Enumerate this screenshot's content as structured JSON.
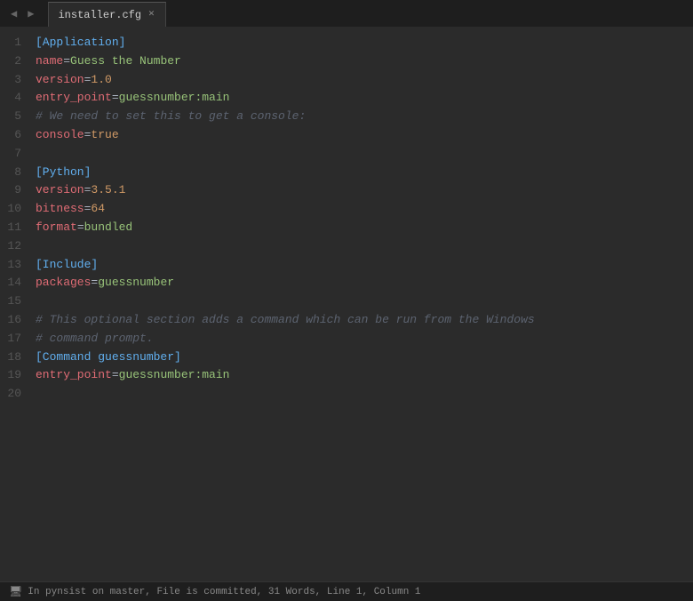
{
  "titleBar": {
    "navBack": "◀",
    "navForward": "▶",
    "tab": {
      "label": "installer.cfg",
      "closeIcon": "✕"
    }
  },
  "lines": [
    {
      "num": 1,
      "tokens": [
        {
          "text": "[Application]",
          "cls": "section"
        }
      ]
    },
    {
      "num": 2,
      "tokens": [
        {
          "text": "name",
          "cls": "key"
        },
        {
          "text": "=",
          "cls": "plain"
        },
        {
          "text": "Guess the Number",
          "cls": "value"
        }
      ]
    },
    {
      "num": 3,
      "tokens": [
        {
          "text": "version",
          "cls": "key"
        },
        {
          "text": "=",
          "cls": "plain"
        },
        {
          "text": "1.0",
          "cls": "value-num"
        }
      ]
    },
    {
      "num": 4,
      "tokens": [
        {
          "text": "entry_point",
          "cls": "key"
        },
        {
          "text": "=",
          "cls": "plain"
        },
        {
          "text": "guessnumber:main",
          "cls": "value"
        }
      ]
    },
    {
      "num": 5,
      "tokens": [
        {
          "text": "# We need to set this to get a console:",
          "cls": "comment"
        }
      ]
    },
    {
      "num": 6,
      "tokens": [
        {
          "text": "console",
          "cls": "key"
        },
        {
          "text": "=",
          "cls": "plain"
        },
        {
          "text": "true",
          "cls": "value-bool"
        }
      ]
    },
    {
      "num": 7,
      "tokens": []
    },
    {
      "num": 8,
      "tokens": [
        {
          "text": "[Python]",
          "cls": "section"
        }
      ]
    },
    {
      "num": 9,
      "tokens": [
        {
          "text": "version",
          "cls": "key"
        },
        {
          "text": "=",
          "cls": "plain"
        },
        {
          "text": "3.5.1",
          "cls": "value-num"
        }
      ]
    },
    {
      "num": 10,
      "tokens": [
        {
          "text": "bitness",
          "cls": "key"
        },
        {
          "text": "=",
          "cls": "plain"
        },
        {
          "text": "64",
          "cls": "value-num"
        }
      ]
    },
    {
      "num": 11,
      "tokens": [
        {
          "text": "format",
          "cls": "key"
        },
        {
          "text": "=",
          "cls": "plain"
        },
        {
          "text": "bundled",
          "cls": "value"
        }
      ]
    },
    {
      "num": 12,
      "tokens": []
    },
    {
      "num": 13,
      "tokens": [
        {
          "text": "[Include]",
          "cls": "section"
        }
      ]
    },
    {
      "num": 14,
      "tokens": [
        {
          "text": "packages",
          "cls": "key"
        },
        {
          "text": "=",
          "cls": "plain"
        },
        {
          "text": "guessnumber",
          "cls": "value"
        }
      ]
    },
    {
      "num": 15,
      "tokens": []
    },
    {
      "num": 16,
      "tokens": [
        {
          "text": "# This optional section adds a command which can be run from the Windows",
          "cls": "comment"
        }
      ]
    },
    {
      "num": 17,
      "tokens": [
        {
          "text": "# command prompt.",
          "cls": "comment"
        }
      ]
    },
    {
      "num": 18,
      "tokens": [
        {
          "text": "[Command guessnumber]",
          "cls": "section"
        }
      ]
    },
    {
      "num": 19,
      "tokens": [
        {
          "text": "entry_point",
          "cls": "key"
        },
        {
          "text": "=",
          "cls": "plain"
        },
        {
          "text": "guessnumber:main",
          "cls": "value"
        }
      ]
    },
    {
      "num": 20,
      "tokens": []
    }
  ],
  "statusBar": {
    "icon": "🖥",
    "text": "In pynsist on master, File is committed, 31 Words, Line 1, Column 1"
  }
}
